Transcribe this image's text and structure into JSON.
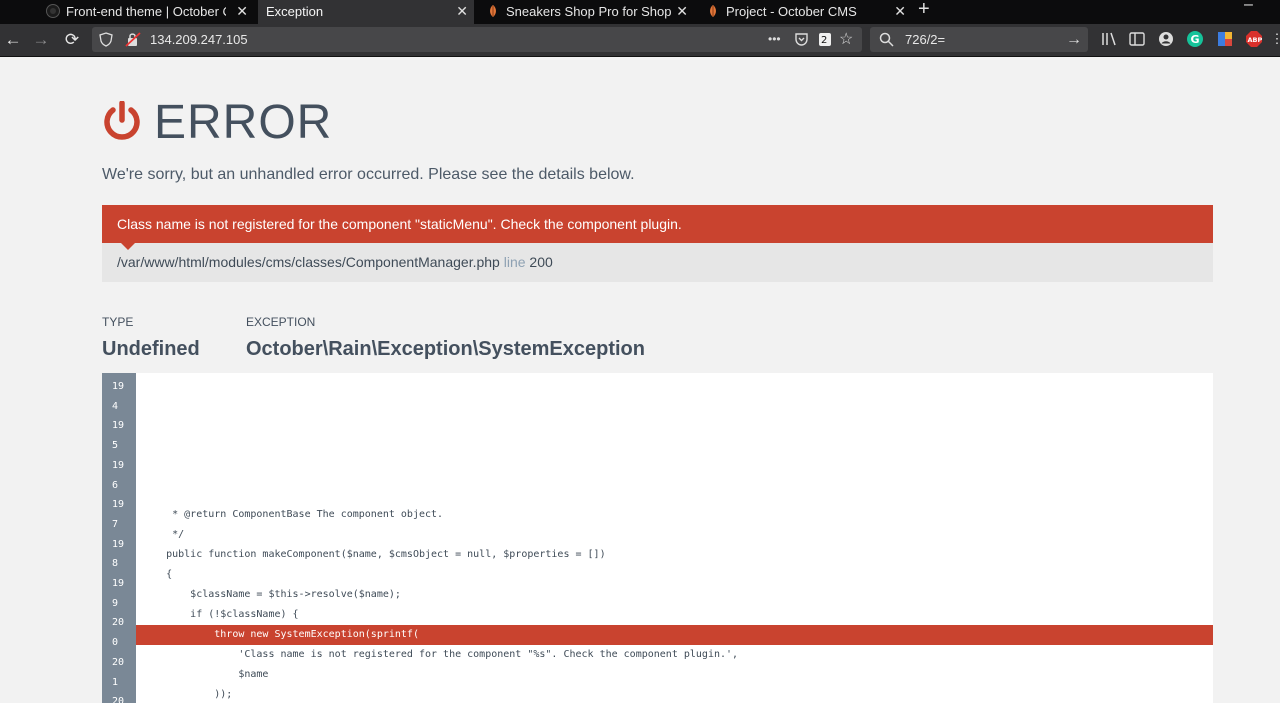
{
  "browser": {
    "tabs": [
      {
        "label": "Front-end theme | October C",
        "icon": "github-icon",
        "active": false
      },
      {
        "label": "Exception",
        "icon": "",
        "active": true
      },
      {
        "label": "Sneakers Shop Pro for Shop",
        "icon": "october-icon",
        "active": false
      },
      {
        "label": "Project - October CMS",
        "icon": "october-icon",
        "active": false
      }
    ],
    "close_glyph": "✕",
    "new_tab_glyph": "+",
    "minimize_glyph": "–",
    "url": "134.209.247.105",
    "search_value": "726/2=",
    "page_actions_glyph": "•••"
  },
  "error": {
    "title": "ERROR",
    "subtitle": "We're sorry, but an unhandled error occurred. Please see the details below.",
    "message": "Class name is not registered for the component \"staticMenu\". Check the component plugin.",
    "file": "/var/www/html/modules/cms/classes/ComponentManager.php",
    "line_word": "line",
    "line_number": "200",
    "type_label": "TYPE",
    "type_value": "Undefined",
    "exception_label": "EXCEPTION",
    "exception_value": "October\\Rain\\Exception\\SystemException"
  },
  "colors": {
    "accent": "#c9432f",
    "text": "#44505e",
    "gutter": "#7a8896"
  },
  "code": {
    "gutter_numbers": [
      "19",
      "4",
      "19",
      "5",
      "19",
      "6",
      "19",
      "7",
      "19",
      "8",
      "19",
      "9",
      "20",
      "0",
      "20",
      "1",
      "20"
    ],
    "lines": [
      "",
      "",
      "",
      "",
      "",
      "",
      "      * @return ComponentBase The component object.",
      "      */",
      "     public function makeComponent($name, $cmsObject = null, $properties = [])",
      "     {",
      "         $className = $this->resolve($name);",
      "         if (!$className) {",
      "             throw new SystemException(sprintf(",
      "                 'Class name is not registered for the component \"%s\". Check the component plugin.',",
      "                 $name",
      "             ));",
      ""
    ],
    "highlighted_line_index": 12
  }
}
